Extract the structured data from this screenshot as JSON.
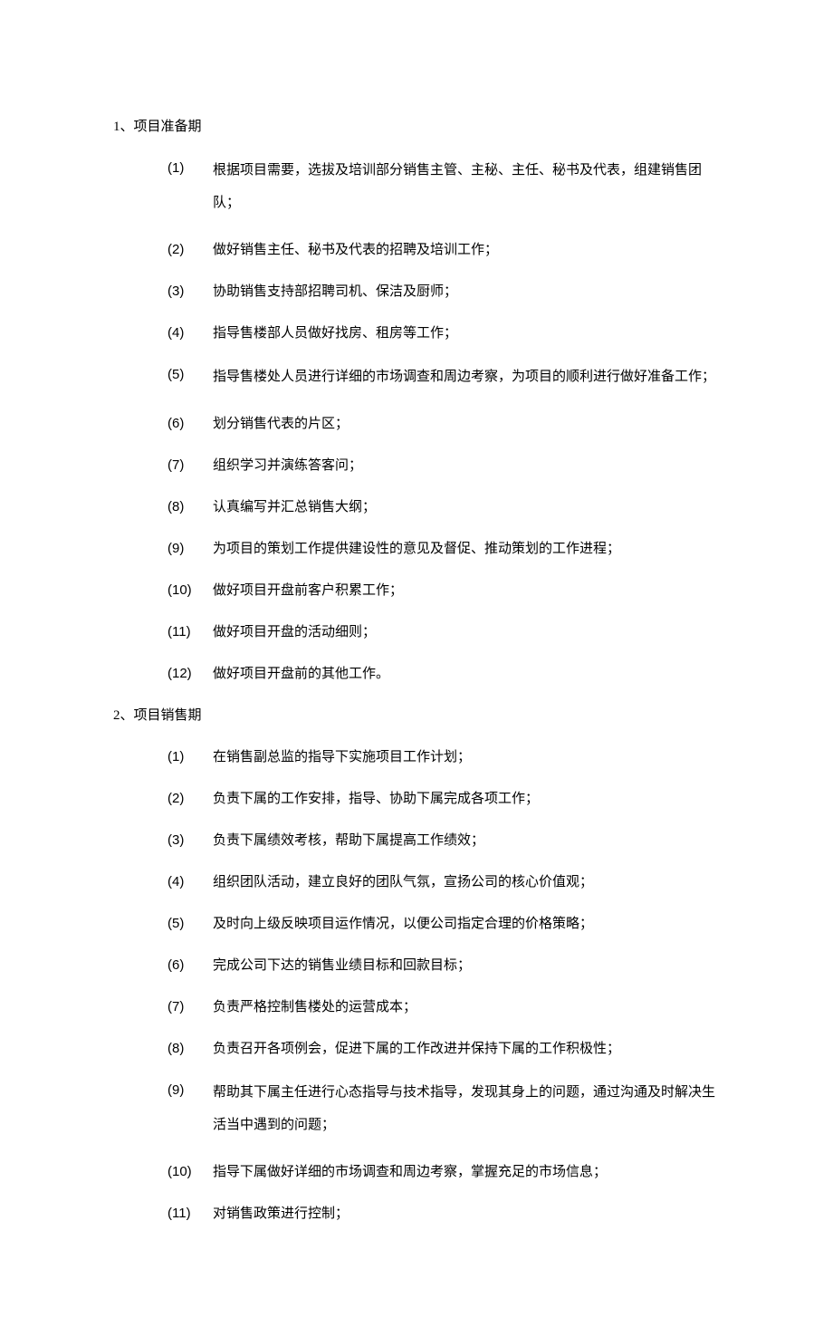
{
  "sections": [
    {
      "heading": "1、项目准备期",
      "items": [
        {
          "num": "(1)",
          "text": "根据项目需要，选拔及培训部分销售主管、主秘、主任、秘书及代表，组建销售团队；",
          "multi": true
        },
        {
          "num": "(2)",
          "text": "做好销售主任、秘书及代表的招聘及培训工作；"
        },
        {
          "num": "(3)",
          "text": "协助销售支持部招聘司机、保洁及厨师；"
        },
        {
          "num": "(4)",
          "text": "指导售楼部人员做好找房、租房等工作；"
        },
        {
          "num": "(5)",
          "text": "指导售楼处人员进行详细的市场调查和周边考察，为项目的顺利进行做好准备工作；",
          "multi": true
        },
        {
          "num": "(6)",
          "text": "划分销售代表的片区；"
        },
        {
          "num": "(7)",
          "text": "组织学习并演练答客问；"
        },
        {
          "num": "(8)",
          "text": "认真编写并汇总销售大纲；"
        },
        {
          "num": "(9)",
          "text": "为项目的策划工作提供建设性的意见及督促、推动策划的工作进程；"
        },
        {
          "num": "(10)",
          "text": "做好项目开盘前客户积累工作；"
        },
        {
          "num": "(11)",
          "text": "做好项目开盘的活动细则；"
        },
        {
          "num": "(12)",
          "text": "做好项目开盘前的其他工作。"
        }
      ]
    },
    {
      "heading": "2、项目销售期",
      "items": [
        {
          "num": "(1)",
          "text": "在销售副总监的指导下实施项目工作计划；"
        },
        {
          "num": "(2)",
          "text": "负责下属的工作安排，指导、协助下属完成各项工作；"
        },
        {
          "num": "(3)",
          "text": "负责下属绩效考核，帮助下属提高工作绩效；"
        },
        {
          "num": "(4)",
          "text": "组织团队活动，建立良好的团队气氛，宣扬公司的核心价值观；"
        },
        {
          "num": "(5)",
          "text": "及时向上级反映项目运作情况，以便公司指定合理的价格策略；"
        },
        {
          "num": "(6)",
          "text": "完成公司下达的销售业绩目标和回款目标；"
        },
        {
          "num": "(7)",
          "text": "负责严格控制售楼处的运营成本；"
        },
        {
          "num": "(8)",
          "text": "负责召开各项例会，促进下属的工作改进并保持下属的工作积极性；"
        },
        {
          "num": "(9)",
          "text": "帮助其下属主任进行心态指导与技术指导，发现其身上的问题，通过沟通及时解决生活当中遇到的问题；",
          "multi": true
        },
        {
          "num": "(10)",
          "text": "指导下属做好详细的市场调查和周边考察，掌握充足的市场信息；"
        },
        {
          "num": "(11)",
          "text": "对销售政策进行控制；"
        }
      ]
    }
  ]
}
